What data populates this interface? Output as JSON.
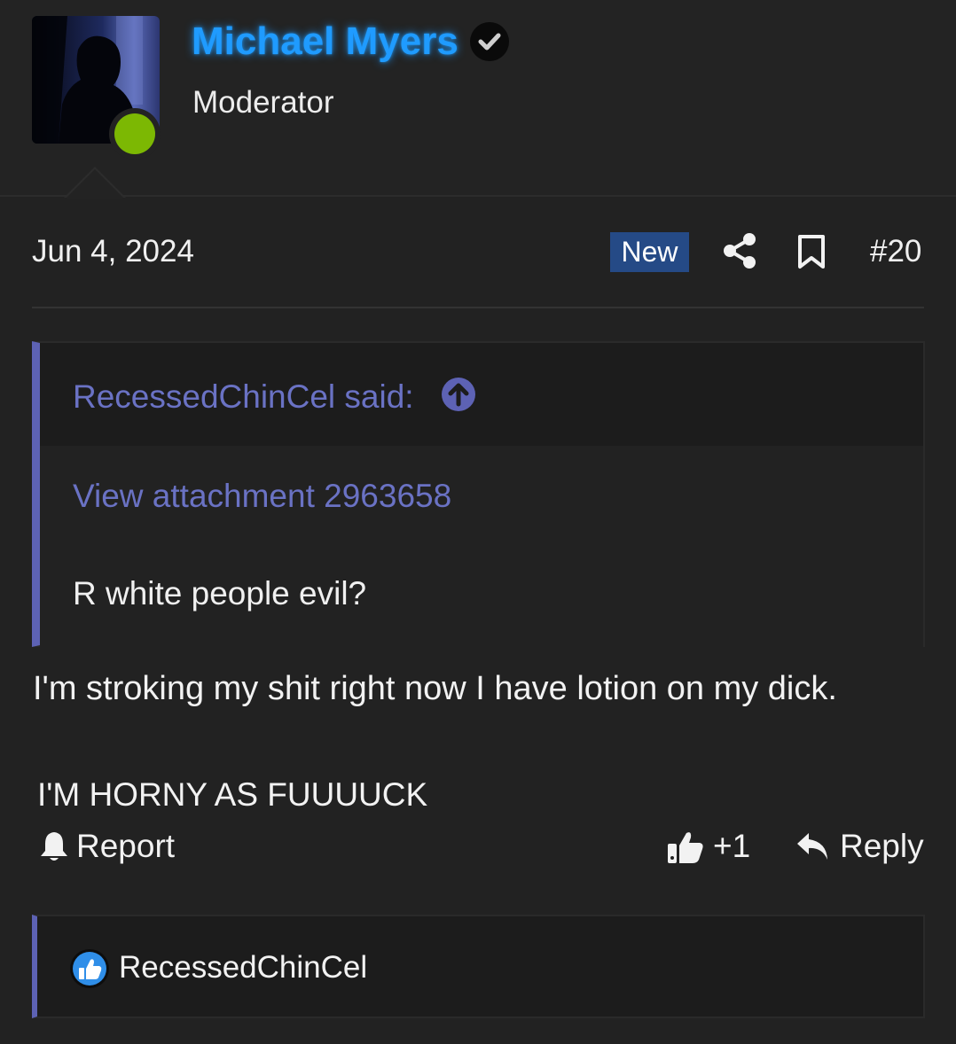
{
  "user": {
    "name": "Michael Myers",
    "role": "Moderator",
    "name_color": "#1f9bff",
    "online_color": "#7cb803"
  },
  "post": {
    "date": "Jun 4, 2024",
    "badge": "New",
    "number": "#20"
  },
  "quote": {
    "author": "RecessedChinCel said:",
    "attachment_link": "View attachment 2963658",
    "text": "R white people evil?",
    "accent_color": "#5d62b4"
  },
  "message": {
    "line1": "I'm stroking my shit right now I have lotion on my dick.",
    "line2": "I'M HORNY AS FUUUUCK"
  },
  "actions": {
    "report": "Report",
    "like_count": "+1",
    "reply": "Reply"
  },
  "reactions": {
    "users": [
      "RecessedChinCel"
    ]
  }
}
